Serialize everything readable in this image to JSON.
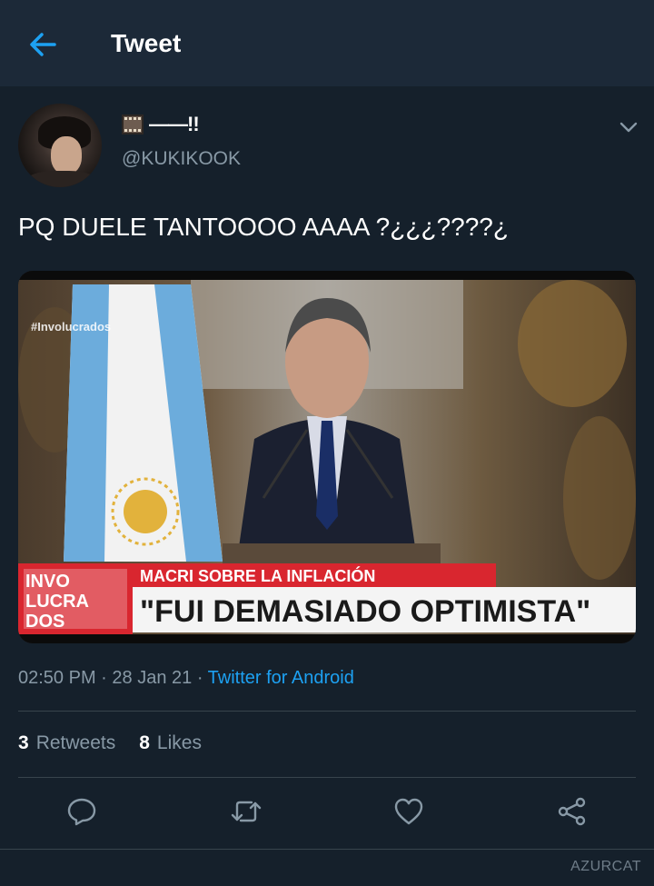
{
  "header": {
    "title": "Tweet"
  },
  "user": {
    "name": "——!!",
    "handle": "@KUKIKOOK",
    "emoji": "film-frames"
  },
  "tweet": {
    "text": "PQ DUELE TANTOOOO AAAA ?¿¿¿????¿",
    "time": "02:50 PM",
    "date": "28 Jan 21",
    "source": "Twitter for Android"
  },
  "media": {
    "hashtag": "#Involucrados",
    "ticker_top": "MACRI SOBRE LA INFLACIÓN",
    "ticker_main": "\"FUI DEMASIADO OPTIMISTA\"",
    "logo_lines": [
      "INVO",
      "LUCRA",
      "DOS"
    ]
  },
  "stats": {
    "retweets_count": "3",
    "retweets_label": "Retweets",
    "likes_count": "8",
    "likes_label": "Likes"
  },
  "watermark": "AZURCAT",
  "colors": {
    "background": "#15202b",
    "header": "#1c2938",
    "accent": "#1da1f2",
    "muted": "#8899a6",
    "divider": "#38444d"
  }
}
